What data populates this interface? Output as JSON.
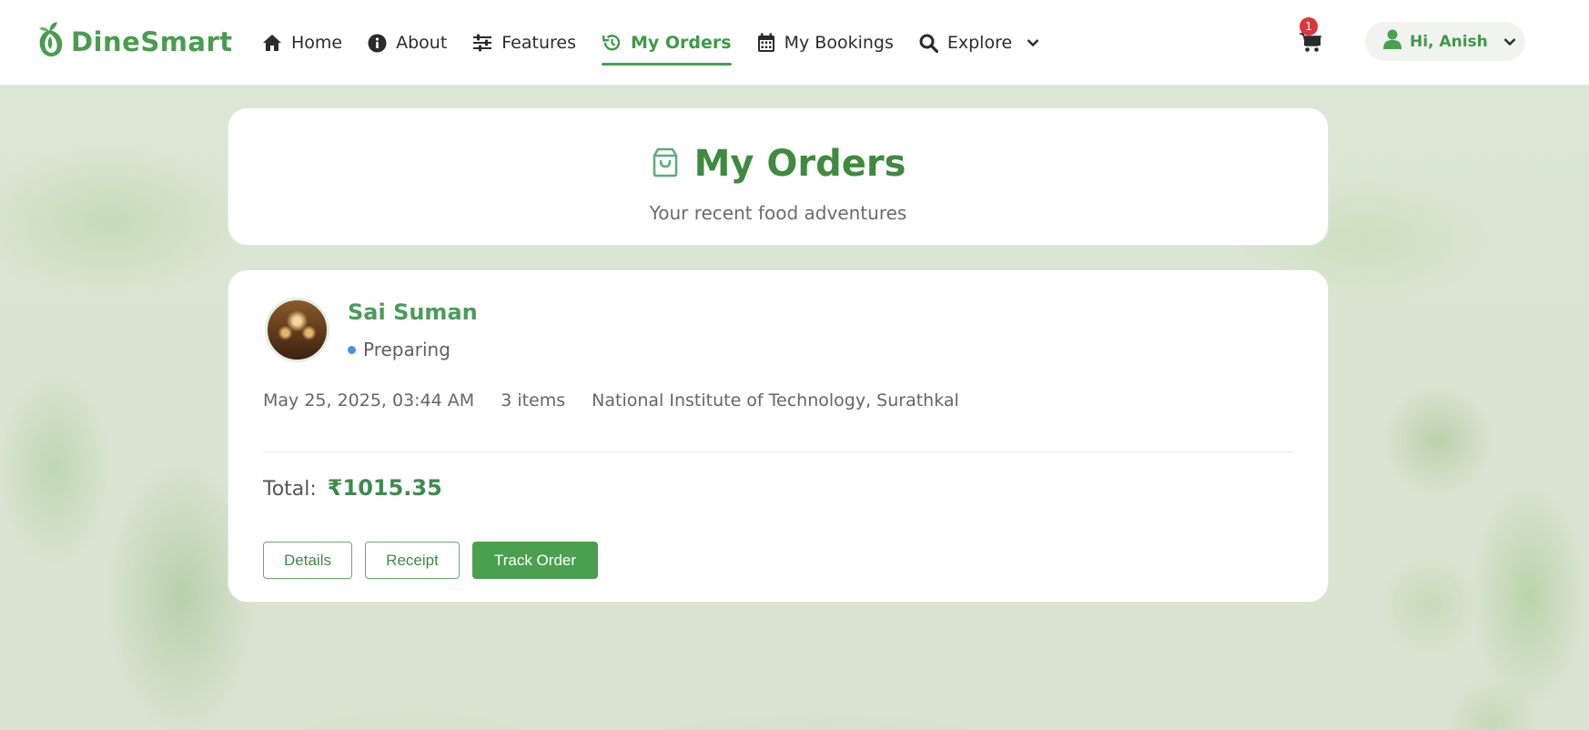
{
  "brand": {
    "name": "DineSmart",
    "color": "#4a9c4f"
  },
  "nav": {
    "items": [
      {
        "label": "Home",
        "icon": "home-icon"
      },
      {
        "label": "About",
        "icon": "info-icon"
      },
      {
        "label": "Features",
        "icon": "sliders-icon"
      },
      {
        "label": "My Orders",
        "icon": "history-icon",
        "active": true
      },
      {
        "label": "My Bookings",
        "icon": "calendar-icon"
      },
      {
        "label": "Explore",
        "icon": "search-icon",
        "dropdown": true
      }
    ],
    "cart_count": "1",
    "user_label": "Hi, Anish"
  },
  "header": {
    "title": "My Orders",
    "subtitle": "Your recent food adventures",
    "icon": "shopping-bag-icon"
  },
  "order": {
    "restaurant": "Sai Suman",
    "status": "Preparing",
    "status_color": "#4a8fe8",
    "date": "May 25, 2025, 03:44 AM",
    "items": "3 items",
    "location": "National Institute of Technology, Surathkal",
    "total_label": "Total:",
    "total_value": "₹1015.35",
    "buttons": {
      "details": "Details",
      "receipt": "Receipt",
      "track": "Track Order"
    }
  },
  "colors": {
    "accent": "#4aa04f",
    "badge": "#d9363e"
  }
}
